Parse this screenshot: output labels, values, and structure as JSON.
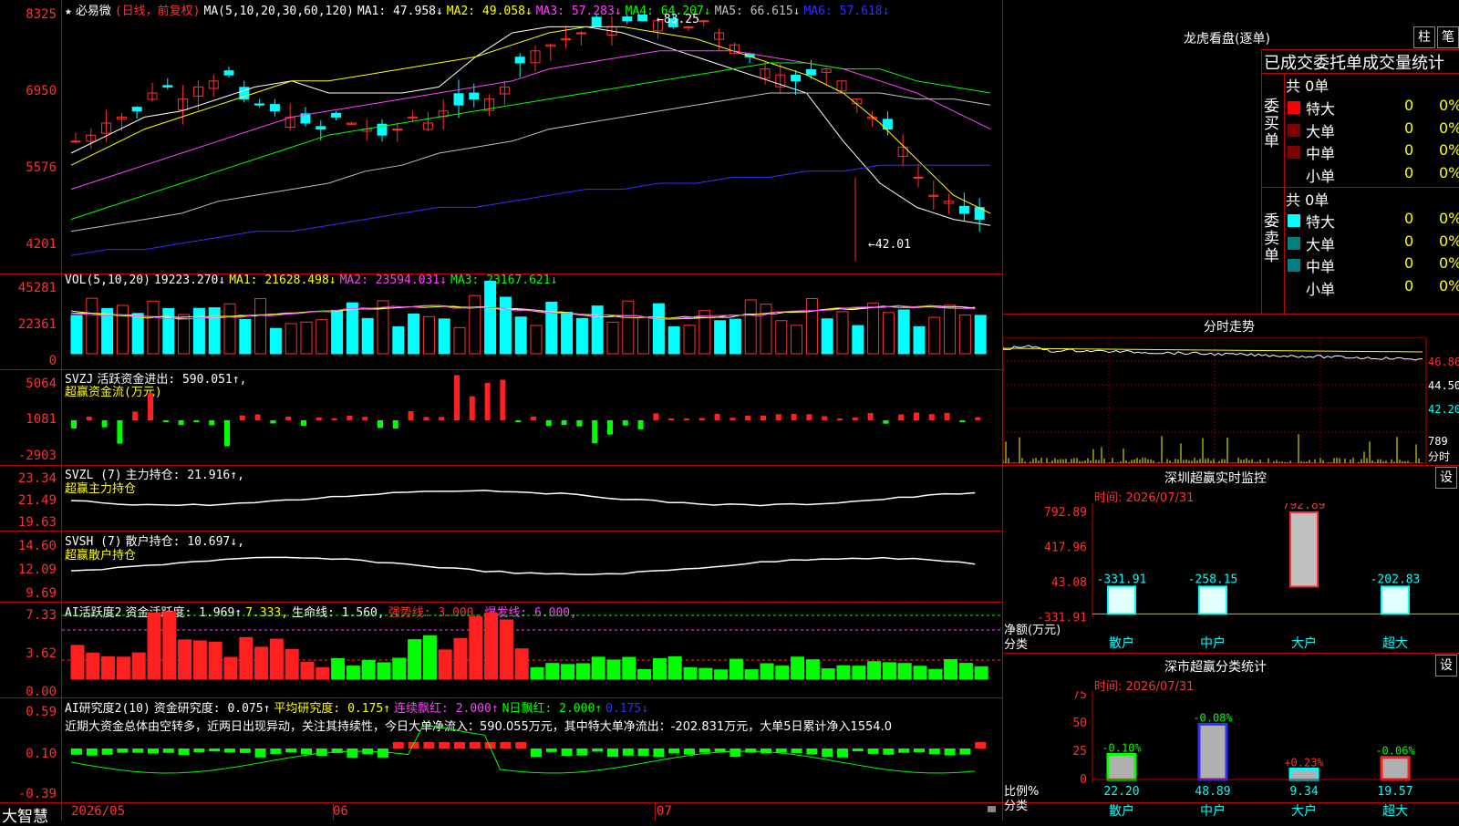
{
  "stock": {
    "star": "★",
    "name": "必易微",
    "mode": "(日线，前复权)"
  },
  "ma_header": {
    "label": "MA(5,10,20,30,60,120)",
    "ma1": "MA1: 47.958↓",
    "ma2": "MA2: 49.058↓",
    "ma3": "MA3: 57.283↓",
    "ma4": "MA4: 64.207↓",
    "ma5": "MA5: 66.615↓",
    "ma6": "MA6: 57.618↓"
  },
  "price_axis": [
    "8325",
    "6950",
    "5576",
    "4201"
  ],
  "price_annotations": {
    "high": "83.25",
    "low": "42.01"
  },
  "vol_header": {
    "label": "VOL(5,10,20)",
    "vol": "19223.270↓",
    "ma1": "MA1: 21628.498↓",
    "ma2": "MA2: 23594.031↓",
    "ma3": "MA3: 23167.621↓"
  },
  "vol_axis": [
    "45281",
    "22361",
    "0"
  ],
  "svzj": {
    "label": "SVZJ",
    "name": "活跃资金进出: 590.051↑,",
    "sub": "超赢资金流(万元)",
    "axis": [
      "5064",
      "1081",
      "-2903"
    ]
  },
  "svzl": {
    "label": "SVZL (7)",
    "name": "主力持仓: 21.916↑,",
    "sub": "超赢主力持仓",
    "axis": [
      "23.34",
      "21.49",
      "19.63"
    ]
  },
  "svsh": {
    "label": "SVSH (7)",
    "name": "散户持仓: 10.697↓,",
    "sub": "超赢散户持仓",
    "axis": [
      "14.60",
      "12.09",
      "9.69"
    ]
  },
  "ai1": {
    "label": "AI活跃度2",
    "a": "资金活跃度: 1.969↑",
    "b": "7.333,",
    "c": "生命线: 1.560,",
    "d": "强势线: 3.000,",
    "e": "爆发线: 6.000,",
    "axis": [
      "7.33",
      "3.62",
      "0.00"
    ]
  },
  "ai2": {
    "label": "AI研究度2(10)",
    "a": "资金研究度: 0.075↑",
    "b": "平均研究度: 0.175↑",
    "c": "连续飘红: 2.000↑",
    "d": "N日飘红: 2.000↑",
    "e": "0.175↓",
    "axis": [
      "0.59",
      "0.10",
      "-0.39"
    ],
    "comment": "近期大资金总体由空转多，近两日出现异动，关注其持续性，今日大单净流入：590.055万元，其中特大单净流出：-202.831万元，大单5日累计净入1554.0"
  },
  "bottom": {
    "logo": "大智慧",
    "dates": [
      "2026/05",
      "06",
      "07"
    ]
  },
  "right": {
    "title": "龙虎看盘(逐单)",
    "tab1": "柱",
    "tab2": "笔",
    "stats_title": "已成交委托单成交量统计",
    "buy": {
      "side": "委买单",
      "total": "共 0单",
      "rows": [
        {
          "n": "特大",
          "v": "0",
          "p": "0%",
          "c": "#ff0000"
        },
        {
          "n": "大单",
          "v": "0",
          "p": "0%",
          "c": "#800000"
        },
        {
          "n": "中单",
          "v": "0",
          "p": "0%",
          "c": "#800000"
        },
        {
          "n": "小单",
          "v": "0",
          "p": "0%",
          "c": ""
        }
      ]
    },
    "sell": {
      "side": "委卖单",
      "total": "共 0单",
      "rows": [
        {
          "n": "特大",
          "v": "0",
          "p": "0%",
          "c": "#00ffff"
        },
        {
          "n": "大单",
          "v": "0",
          "p": "0%",
          "c": "#008080"
        },
        {
          "n": "中单",
          "v": "0",
          "p": "0%",
          "c": "#008080"
        },
        {
          "n": "小单",
          "v": "0",
          "p": "0%",
          "c": ""
        }
      ]
    },
    "intraday_title": "分时走势",
    "intraday_axis": [
      "46.86",
      "44.50",
      "42.20"
    ],
    "intraday_vol": "789",
    "intraday_vol_unit": "分时",
    "sz_monitor": {
      "title": "深圳超赢实时监控",
      "settings": "设",
      "time": "时间: 2026/07/31",
      "axis": [
        "792.89",
        "417.96",
        "43.08",
        "-331.91"
      ],
      "bars": [
        {
          "label": "散户",
          "value": "-331.91",
          "num": -331.91
        },
        {
          "label": "中户",
          "value": "-258.15",
          "num": -258.15
        },
        {
          "label": "大户",
          "value": "792.89",
          "num": 792.89
        },
        {
          "label": "超大",
          "value": "-202.83",
          "num": -202.83
        }
      ],
      "ylabel1": "净额(万元)",
      "ylabel2": "分类"
    },
    "sz_class": {
      "title": "深市超赢分类统计",
      "settings": "设",
      "time": "时间: 2026/07/31",
      "axis": [
        "75",
        "50",
        "25",
        "0"
      ],
      "bars": [
        {
          "label": "散户",
          "value": "22.20",
          "chg": "-0.10%",
          "num": 22.2
        },
        {
          "label": "中户",
          "value": "48.89",
          "chg": "-0.08%",
          "num": 48.89
        },
        {
          "label": "大户",
          "value": "9.34",
          "chg": "+0.23%",
          "num": 9.34
        },
        {
          "label": "超大",
          "value": "19.57",
          "chg": "-0.06%",
          "num": 19.57
        }
      ],
      "ylabel1": "比例%",
      "ylabel2": "分类"
    }
  }
}
